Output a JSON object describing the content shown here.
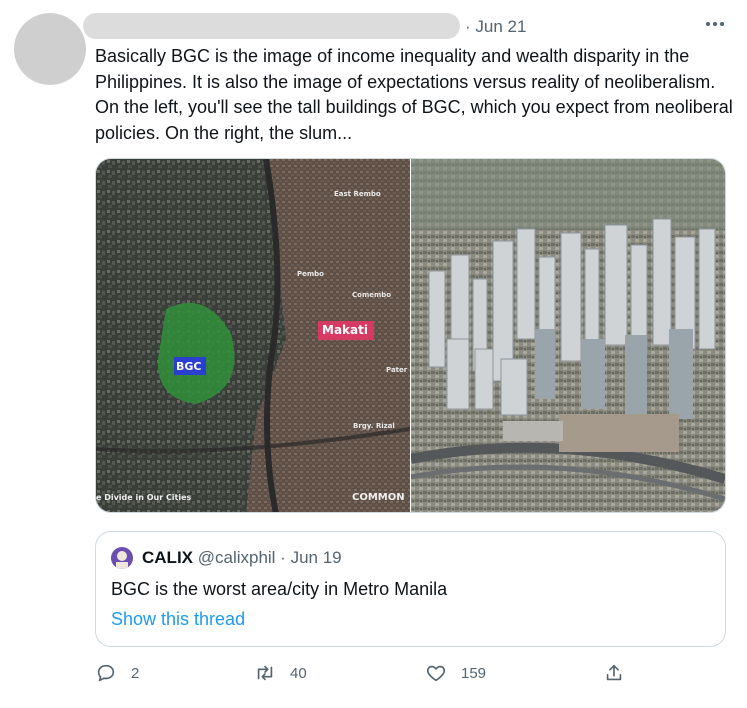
{
  "tweet": {
    "date": "Jun 21",
    "text": "Basically BGC is the image of income inequality and wealth disparity in the Philippines. It is also the image of expectations versus reality of neoliberalism. On the left, you'll see the tall buildings of BGC, which you expect from neoliberal policies. On the right, the slum..."
  },
  "media": {
    "map": {
      "label_bgc": "BGC",
      "label_makati": "Makati",
      "label_east_rembo": "East Rembo",
      "label_pembo": "Pembo",
      "label_comembo": "Comembo",
      "label_pater": "Pater",
      "label_rizal": "Brgy. Rizal",
      "caption": "e Divide in Our Cities",
      "brand": "COMMON"
    },
    "colors": {
      "bgc_badge": "#2a3fd0",
      "makati_badge": "#d63a63",
      "park": "#2f8f3a"
    }
  },
  "quote": {
    "name": "CALIX",
    "handle": "@calixphil · Jun 19",
    "text": "BGC is the worst area/city in Metro Manila",
    "link": "Show this thread"
  },
  "actions": {
    "reply_count": "2",
    "retweet_count": "40",
    "like_count": "159"
  },
  "icons": [
    "more-icon",
    "reply-icon",
    "retweet-icon",
    "like-icon",
    "share-icon"
  ],
  "accent": "#1d9bf0"
}
